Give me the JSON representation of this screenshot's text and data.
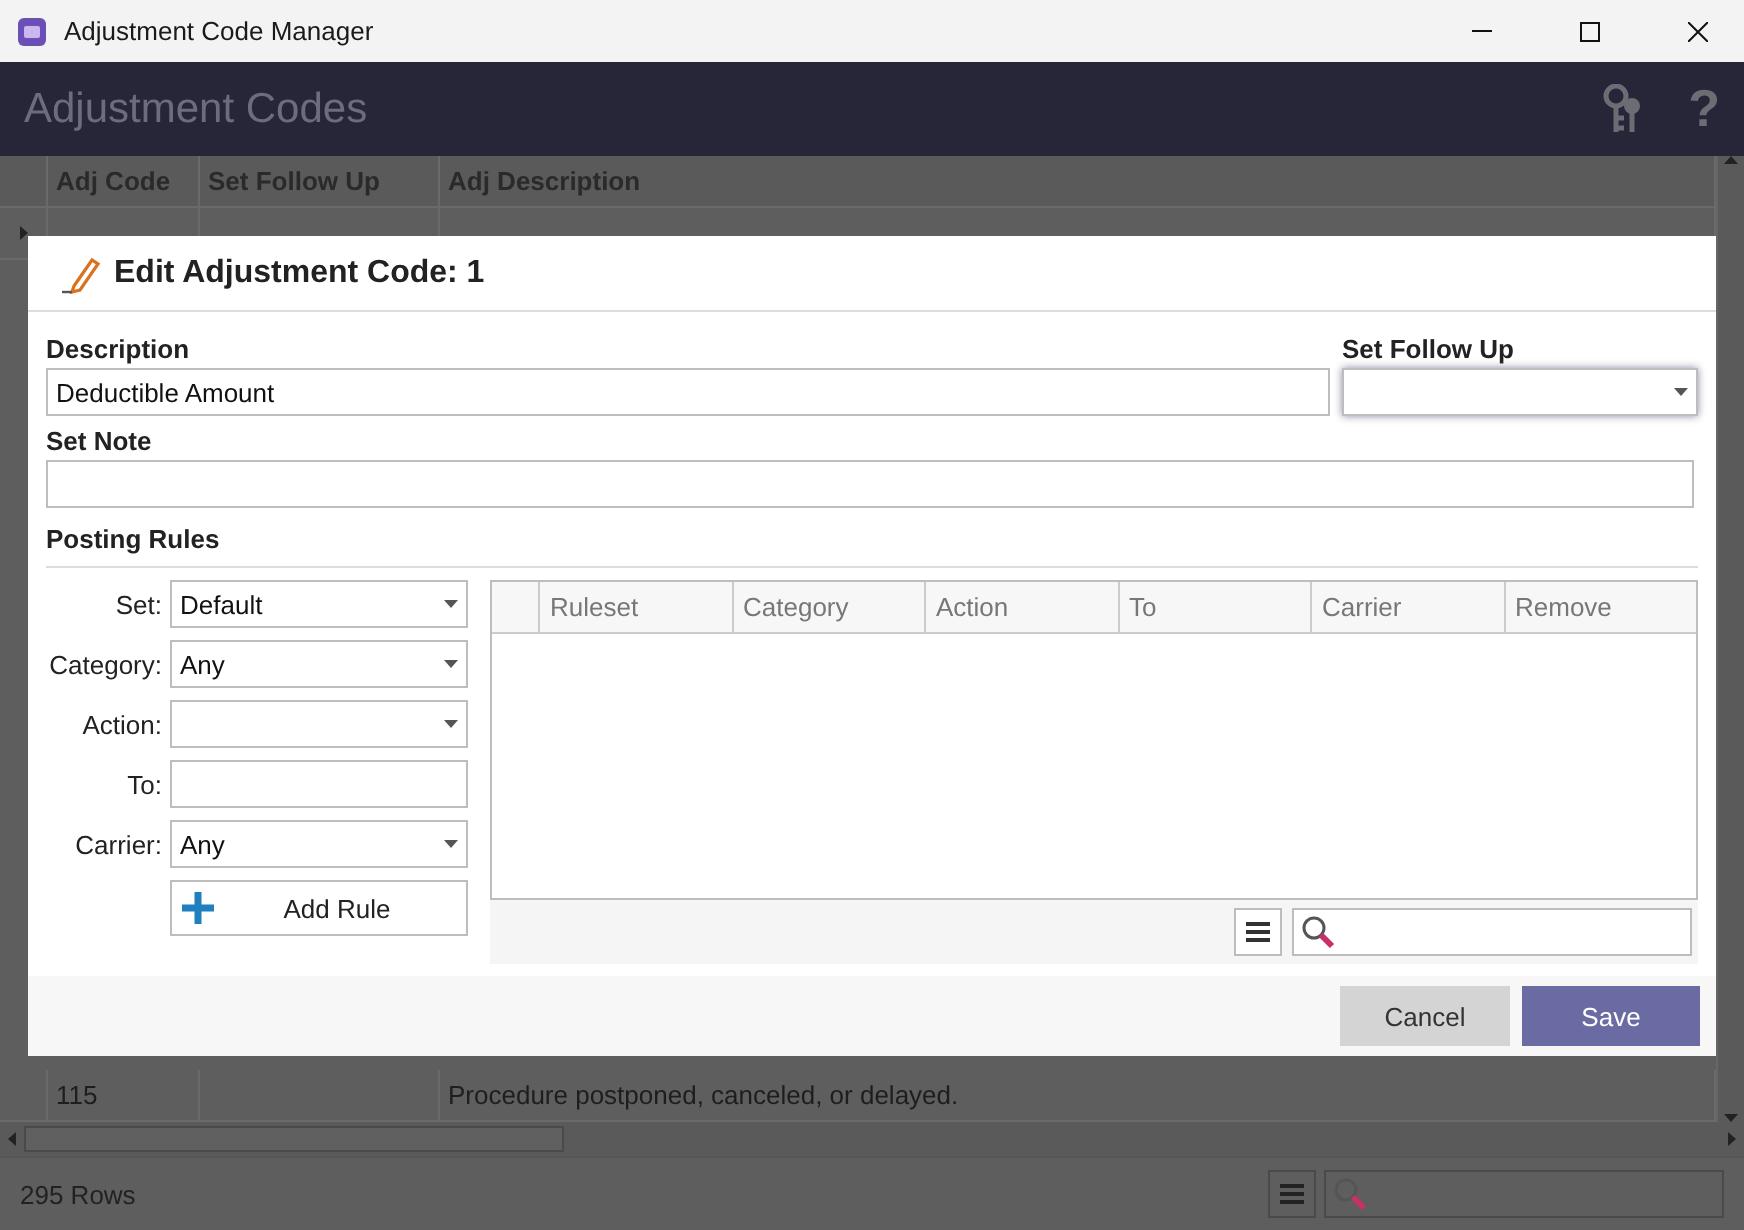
{
  "window": {
    "title": "Adjustment Code Manager"
  },
  "header": {
    "title": "Adjustment Codes",
    "help_glyph": "?"
  },
  "grid": {
    "columns": [
      "Adj Code",
      "Set Follow Up",
      "Adj Description"
    ],
    "rows": [
      {
        "current": true
      },
      {
        "code": "115",
        "description": "Procedure postponed, canceled, or delayed.",
        "current": false
      }
    ]
  },
  "status_bar": {
    "row_count": "295 Rows"
  },
  "dialog": {
    "title": "Edit Adjustment Code: 1",
    "description": {
      "label": "Description",
      "value": "Deductible Amount"
    },
    "follow_up": {
      "label": "Set Follow Up",
      "focused": true
    },
    "note": {
      "label": "Set Note"
    },
    "posting_rules": {
      "title": "Posting Rules",
      "fields": [
        {
          "label": "Set:",
          "kind": "dropdown",
          "value": "Default"
        },
        {
          "label": "Category:",
          "kind": "dropdown",
          "value": "Any"
        },
        {
          "label": "Action:",
          "kind": "dropdown"
        },
        {
          "label": "To:",
          "kind": "text"
        },
        {
          "label": "Carrier:",
          "kind": "dropdown",
          "value": "Any"
        }
      ],
      "add_button": "Add Rule",
      "columns": [
        "Ruleset",
        "Category",
        "Action",
        "To",
        "Carrier",
        "Remove"
      ]
    },
    "buttons": [
      {
        "label": "Cancel",
        "kind": "secondary"
      },
      {
        "label": "Save",
        "kind": "primary"
      }
    ]
  }
}
